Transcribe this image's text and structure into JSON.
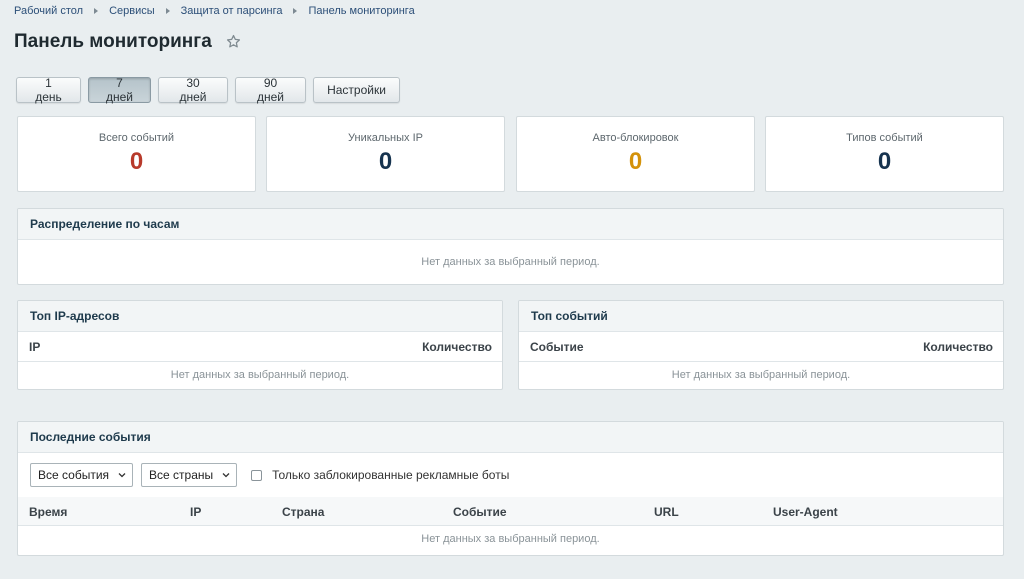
{
  "breadcrumb": [
    "Рабочий стол",
    "Сервисы",
    "Защита от парсинга",
    "Панель мониторинга"
  ],
  "page_title": "Панель мониторинга",
  "periods": [
    {
      "label": "1 день",
      "active": false
    },
    {
      "label": "7 дней",
      "active": true
    },
    {
      "label": "30 дней",
      "active": false
    },
    {
      "label": "90 дней",
      "active": false
    },
    {
      "label": "Настройки",
      "active": false
    }
  ],
  "stats": [
    {
      "label": "Всего событий",
      "value": "0",
      "color": "#b83a2b"
    },
    {
      "label": "Уникальных IP",
      "value": "0",
      "color": "#16334f"
    },
    {
      "label": "Авто-блокировок",
      "value": "0",
      "color": "#d4920a"
    },
    {
      "label": "Типов событий",
      "value": "0",
      "color": "#16334f"
    }
  ],
  "empty_text": "Нет данных за выбранный период.",
  "hours_panel": {
    "title": "Распределение по часам"
  },
  "top_ip": {
    "title": "Топ IP-адресов",
    "col1": "IP",
    "col2": "Количество"
  },
  "top_events": {
    "title": "Топ событий",
    "col1": "Событие",
    "col2": "Количество"
  },
  "recent": {
    "title": "Последние события",
    "filter_events": "Все события",
    "filter_countries": "Все страны",
    "only_blocked_label": "Только заблокированные рекламные боты",
    "columns": [
      "Время",
      "IP",
      "Страна",
      "Событие",
      "URL",
      "User-Agent"
    ]
  }
}
